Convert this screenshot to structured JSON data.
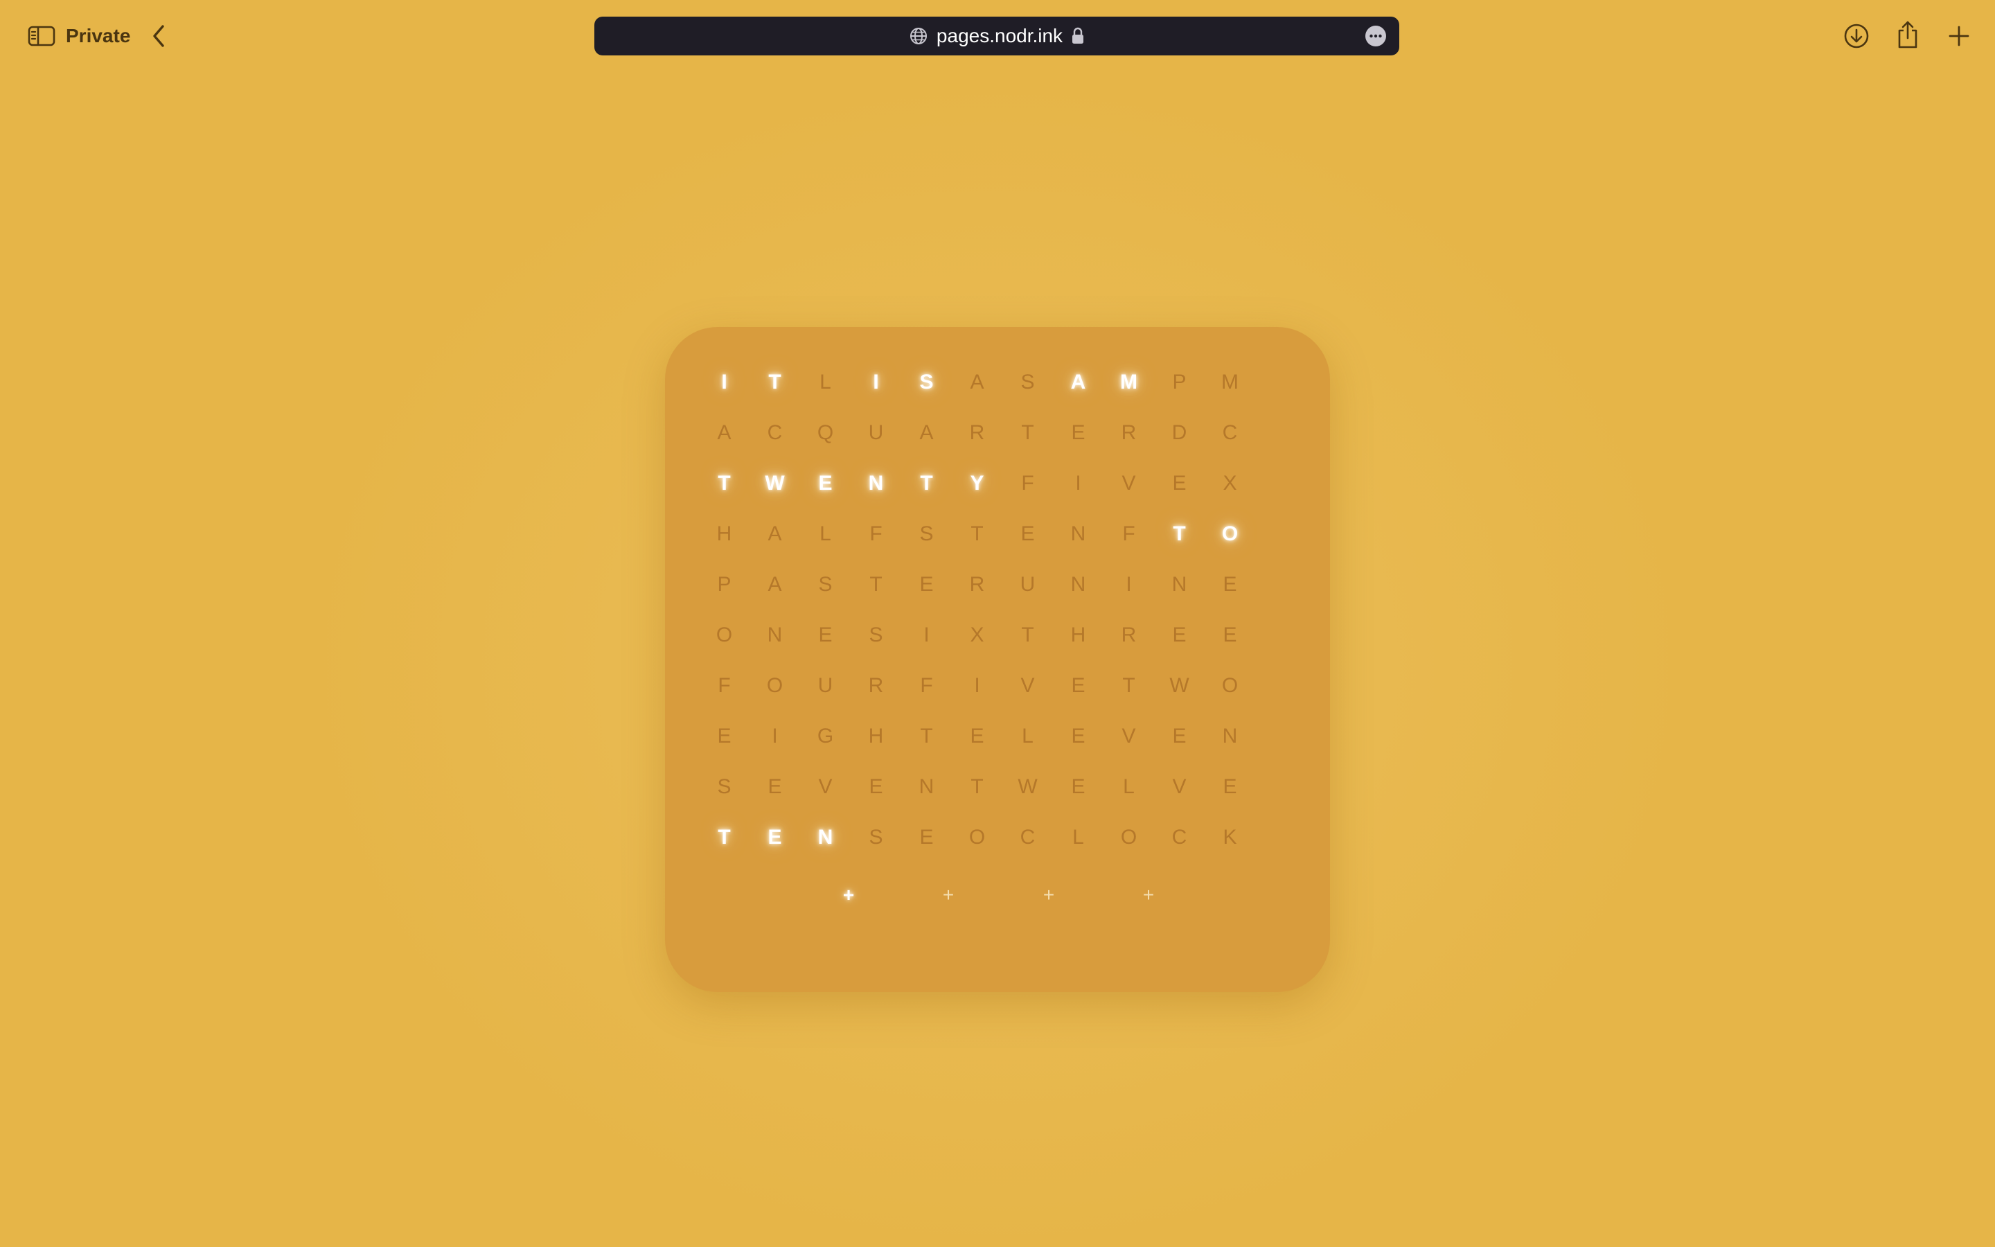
{
  "browser": {
    "mode_label": "Private",
    "url": "pages.nodr.ink",
    "icons": {
      "sidebar": "sidebar-icon",
      "back": "chevron-left-icon",
      "site": "globe-icon",
      "secure": "lock-icon",
      "more": "ellipsis-circle-icon",
      "download": "download-icon",
      "share": "share-icon",
      "new_tab": "plus-icon"
    }
  },
  "clock": {
    "rows": [
      [
        "I",
        "T",
        "L",
        "I",
        "S",
        "A",
        "S",
        "A",
        "M",
        "P",
        "M"
      ],
      [
        "A",
        "C",
        "Q",
        "U",
        "A",
        "R",
        "T",
        "E",
        "R",
        "D",
        "C"
      ],
      [
        "T",
        "W",
        "E",
        "N",
        "T",
        "Y",
        "F",
        "I",
        "V",
        "E",
        "X"
      ],
      [
        "H",
        "A",
        "L",
        "F",
        "S",
        "T",
        "E",
        "N",
        "F",
        "T",
        "O"
      ],
      [
        "P",
        "A",
        "S",
        "T",
        "E",
        "R",
        "U",
        "N",
        "I",
        "N",
        "E"
      ],
      [
        "O",
        "N",
        "E",
        "S",
        "I",
        "X",
        "T",
        "H",
        "R",
        "E",
        "E"
      ],
      [
        "F",
        "O",
        "U",
        "R",
        "F",
        "I",
        "V",
        "E",
        "T",
        "W",
        "O"
      ],
      [
        "E",
        "I",
        "G",
        "H",
        "T",
        "E",
        "L",
        "E",
        "V",
        "E",
        "N"
      ],
      [
        "S",
        "E",
        "V",
        "E",
        "N",
        "T",
        "W",
        "E",
        "L",
        "V",
        "E"
      ],
      [
        "T",
        "E",
        "N",
        "S",
        "E",
        "O",
        "C",
        "L",
        "O",
        "C",
        "K"
      ]
    ],
    "lit": [
      [
        0,
        0
      ],
      [
        0,
        1
      ],
      [
        0,
        3
      ],
      [
        0,
        4
      ],
      [
        0,
        7
      ],
      [
        0,
        8
      ],
      [
        2,
        0
      ],
      [
        2,
        1
      ],
      [
        2,
        2
      ],
      [
        2,
        3
      ],
      [
        2,
        4
      ],
      [
        2,
        5
      ],
      [
        3,
        9
      ],
      [
        3,
        10
      ],
      [
        9,
        0
      ],
      [
        9,
        1
      ],
      [
        9,
        2
      ]
    ],
    "minute_dots": [
      "+",
      "+",
      "+",
      "+"
    ],
    "minute_dots_lit": 1,
    "colors": {
      "background": "#e8b950",
      "card": "#d89c3d",
      "letter_dim": "#b5782a",
      "letter_lit": "#ffffff",
      "address_bar": "#1f1d26"
    }
  }
}
